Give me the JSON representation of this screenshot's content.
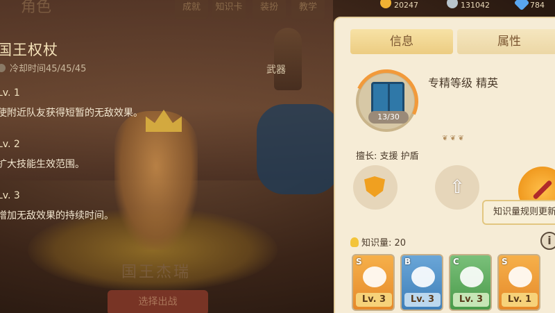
{
  "topnav": {
    "title": "角色",
    "tabs": [
      "成就",
      "知识卡",
      "装扮",
      "教学"
    ],
    "currencies": [
      {
        "value": "20247",
        "color": "#f2b233",
        "icon": "gold-coin-icon"
      },
      {
        "value": "131042",
        "color": "#b8c4cc",
        "icon": "silver-coin-icon"
      },
      {
        "value": "784",
        "color": "#59a6f0",
        "icon": "diamond-icon"
      }
    ]
  },
  "skill": {
    "name": "国王权杖",
    "cooldown": "冷却时间45/45/45",
    "type": "武器",
    "levels": [
      {
        "label": "Lv. 1",
        "desc": "使附近队友获得短暂的无敌效果。"
      },
      {
        "label": "Lv. 2",
        "desc": "扩大技能生效范围。"
      },
      {
        "label": "Lv. 3",
        "desc": "增加无敌效果的持续时间。"
      }
    ]
  },
  "character": {
    "name": "国王杰瑞",
    "select_label": "选择出战"
  },
  "panel": {
    "tab_info": "信息",
    "tab_attr": "属性",
    "progress": "13/30",
    "mastery": "专精等级  精英",
    "specialty": "擅长: 支援  护盾",
    "tooltip": "知识量规则更新",
    "knowledge": "知识量: 20",
    "info_btn": "i",
    "cards": [
      {
        "grade": "S",
        "level": "Lv. 3",
        "class": "card-s"
      },
      {
        "grade": "B",
        "level": "Lv. 3",
        "class": "card-b"
      },
      {
        "grade": "C",
        "level": "Lv. 3",
        "class": "card-c"
      },
      {
        "grade": "S",
        "level": "Lv. 1",
        "class": "card-s"
      }
    ]
  }
}
